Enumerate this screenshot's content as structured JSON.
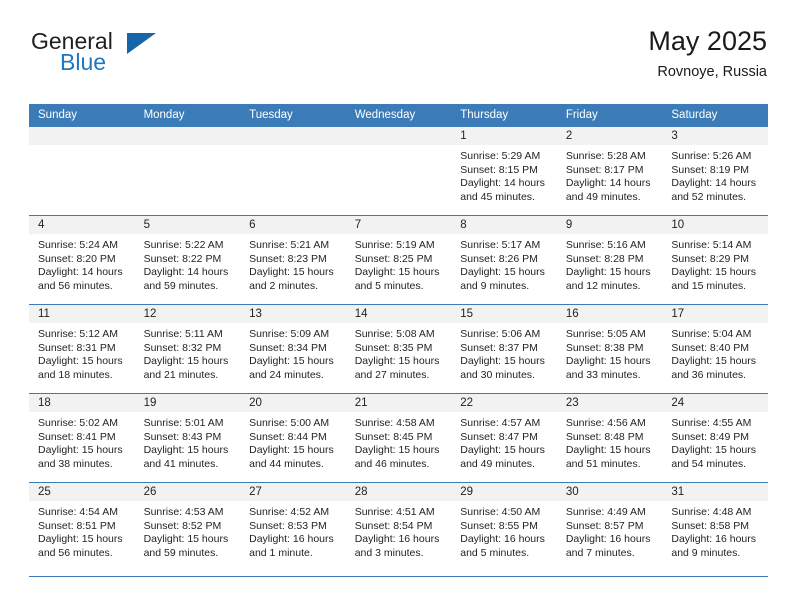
{
  "brand": {
    "name_part1": "General",
    "name_part2": "Blue",
    "logo_icon": "blue-triangle-icon"
  },
  "header": {
    "title": "May 2025",
    "subtitle": "Rovnoye, Russia"
  },
  "colors": {
    "header_blue": "#3b7cb8",
    "brand_blue": "#2077c0",
    "daynum_band": "#f2f2f2",
    "text": "#231f20"
  },
  "calendar": {
    "weekday_headers": [
      "Sunday",
      "Monday",
      "Tuesday",
      "Wednesday",
      "Thursday",
      "Friday",
      "Saturday"
    ],
    "weeks": [
      [
        {
          "day": "",
          "empty": true,
          "sunrise": "",
          "sunset": "",
          "daylight1": "",
          "daylight2": ""
        },
        {
          "day": "",
          "empty": true,
          "sunrise": "",
          "sunset": "",
          "daylight1": "",
          "daylight2": ""
        },
        {
          "day": "",
          "empty": true,
          "sunrise": "",
          "sunset": "",
          "daylight1": "",
          "daylight2": ""
        },
        {
          "day": "",
          "empty": true,
          "sunrise": "",
          "sunset": "",
          "daylight1": "",
          "daylight2": ""
        },
        {
          "day": "1",
          "empty": false,
          "sunrise": "Sunrise: 5:29 AM",
          "sunset": "Sunset: 8:15 PM",
          "daylight1": "Daylight: 14 hours",
          "daylight2": "and 45 minutes."
        },
        {
          "day": "2",
          "empty": false,
          "sunrise": "Sunrise: 5:28 AM",
          "sunset": "Sunset: 8:17 PM",
          "daylight1": "Daylight: 14 hours",
          "daylight2": "and 49 minutes."
        },
        {
          "day": "3",
          "empty": false,
          "sunrise": "Sunrise: 5:26 AM",
          "sunset": "Sunset: 8:19 PM",
          "daylight1": "Daylight: 14 hours",
          "daylight2": "and 52 minutes."
        }
      ],
      [
        {
          "day": "4",
          "empty": false,
          "sunrise": "Sunrise: 5:24 AM",
          "sunset": "Sunset: 8:20 PM",
          "daylight1": "Daylight: 14 hours",
          "daylight2": "and 56 minutes."
        },
        {
          "day": "5",
          "empty": false,
          "sunrise": "Sunrise: 5:22 AM",
          "sunset": "Sunset: 8:22 PM",
          "daylight1": "Daylight: 14 hours",
          "daylight2": "and 59 minutes."
        },
        {
          "day": "6",
          "empty": false,
          "sunrise": "Sunrise: 5:21 AM",
          "sunset": "Sunset: 8:23 PM",
          "daylight1": "Daylight: 15 hours",
          "daylight2": "and 2 minutes."
        },
        {
          "day": "7",
          "empty": false,
          "sunrise": "Sunrise: 5:19 AM",
          "sunset": "Sunset: 8:25 PM",
          "daylight1": "Daylight: 15 hours",
          "daylight2": "and 5 minutes."
        },
        {
          "day": "8",
          "empty": false,
          "sunrise": "Sunrise: 5:17 AM",
          "sunset": "Sunset: 8:26 PM",
          "daylight1": "Daylight: 15 hours",
          "daylight2": "and 9 minutes."
        },
        {
          "day": "9",
          "empty": false,
          "sunrise": "Sunrise: 5:16 AM",
          "sunset": "Sunset: 8:28 PM",
          "daylight1": "Daylight: 15 hours",
          "daylight2": "and 12 minutes."
        },
        {
          "day": "10",
          "empty": false,
          "sunrise": "Sunrise: 5:14 AM",
          "sunset": "Sunset: 8:29 PM",
          "daylight1": "Daylight: 15 hours",
          "daylight2": "and 15 minutes."
        }
      ],
      [
        {
          "day": "11",
          "empty": false,
          "sunrise": "Sunrise: 5:12 AM",
          "sunset": "Sunset: 8:31 PM",
          "daylight1": "Daylight: 15 hours",
          "daylight2": "and 18 minutes."
        },
        {
          "day": "12",
          "empty": false,
          "sunrise": "Sunrise: 5:11 AM",
          "sunset": "Sunset: 8:32 PM",
          "daylight1": "Daylight: 15 hours",
          "daylight2": "and 21 minutes."
        },
        {
          "day": "13",
          "empty": false,
          "sunrise": "Sunrise: 5:09 AM",
          "sunset": "Sunset: 8:34 PM",
          "daylight1": "Daylight: 15 hours",
          "daylight2": "and 24 minutes."
        },
        {
          "day": "14",
          "empty": false,
          "sunrise": "Sunrise: 5:08 AM",
          "sunset": "Sunset: 8:35 PM",
          "daylight1": "Daylight: 15 hours",
          "daylight2": "and 27 minutes."
        },
        {
          "day": "15",
          "empty": false,
          "sunrise": "Sunrise: 5:06 AM",
          "sunset": "Sunset: 8:37 PM",
          "daylight1": "Daylight: 15 hours",
          "daylight2": "and 30 minutes."
        },
        {
          "day": "16",
          "empty": false,
          "sunrise": "Sunrise: 5:05 AM",
          "sunset": "Sunset: 8:38 PM",
          "daylight1": "Daylight: 15 hours",
          "daylight2": "and 33 minutes."
        },
        {
          "day": "17",
          "empty": false,
          "sunrise": "Sunrise: 5:04 AM",
          "sunset": "Sunset: 8:40 PM",
          "daylight1": "Daylight: 15 hours",
          "daylight2": "and 36 minutes."
        }
      ],
      [
        {
          "day": "18",
          "empty": false,
          "sunrise": "Sunrise: 5:02 AM",
          "sunset": "Sunset: 8:41 PM",
          "daylight1": "Daylight: 15 hours",
          "daylight2": "and 38 minutes."
        },
        {
          "day": "19",
          "empty": false,
          "sunrise": "Sunrise: 5:01 AM",
          "sunset": "Sunset: 8:43 PM",
          "daylight1": "Daylight: 15 hours",
          "daylight2": "and 41 minutes."
        },
        {
          "day": "20",
          "empty": false,
          "sunrise": "Sunrise: 5:00 AM",
          "sunset": "Sunset: 8:44 PM",
          "daylight1": "Daylight: 15 hours",
          "daylight2": "and 44 minutes."
        },
        {
          "day": "21",
          "empty": false,
          "sunrise": "Sunrise: 4:58 AM",
          "sunset": "Sunset: 8:45 PM",
          "daylight1": "Daylight: 15 hours",
          "daylight2": "and 46 minutes."
        },
        {
          "day": "22",
          "empty": false,
          "sunrise": "Sunrise: 4:57 AM",
          "sunset": "Sunset: 8:47 PM",
          "daylight1": "Daylight: 15 hours",
          "daylight2": "and 49 minutes."
        },
        {
          "day": "23",
          "empty": false,
          "sunrise": "Sunrise: 4:56 AM",
          "sunset": "Sunset: 8:48 PM",
          "daylight1": "Daylight: 15 hours",
          "daylight2": "and 51 minutes."
        },
        {
          "day": "24",
          "empty": false,
          "sunrise": "Sunrise: 4:55 AM",
          "sunset": "Sunset: 8:49 PM",
          "daylight1": "Daylight: 15 hours",
          "daylight2": "and 54 minutes."
        }
      ],
      [
        {
          "day": "25",
          "empty": false,
          "sunrise": "Sunrise: 4:54 AM",
          "sunset": "Sunset: 8:51 PM",
          "daylight1": "Daylight: 15 hours",
          "daylight2": "and 56 minutes."
        },
        {
          "day": "26",
          "empty": false,
          "sunrise": "Sunrise: 4:53 AM",
          "sunset": "Sunset: 8:52 PM",
          "daylight1": "Daylight: 15 hours",
          "daylight2": "and 59 minutes."
        },
        {
          "day": "27",
          "empty": false,
          "sunrise": "Sunrise: 4:52 AM",
          "sunset": "Sunset: 8:53 PM",
          "daylight1": "Daylight: 16 hours",
          "daylight2": "and 1 minute."
        },
        {
          "day": "28",
          "empty": false,
          "sunrise": "Sunrise: 4:51 AM",
          "sunset": "Sunset: 8:54 PM",
          "daylight1": "Daylight: 16 hours",
          "daylight2": "and 3 minutes."
        },
        {
          "day": "29",
          "empty": false,
          "sunrise": "Sunrise: 4:50 AM",
          "sunset": "Sunset: 8:55 PM",
          "daylight1": "Daylight: 16 hours",
          "daylight2": "and 5 minutes."
        },
        {
          "day": "30",
          "empty": false,
          "sunrise": "Sunrise: 4:49 AM",
          "sunset": "Sunset: 8:57 PM",
          "daylight1": "Daylight: 16 hours",
          "daylight2": "and 7 minutes."
        },
        {
          "day": "31",
          "empty": false,
          "sunrise": "Sunrise: 4:48 AM",
          "sunset": "Sunset: 8:58 PM",
          "daylight1": "Daylight: 16 hours",
          "daylight2": "and 9 minutes."
        }
      ]
    ]
  }
}
